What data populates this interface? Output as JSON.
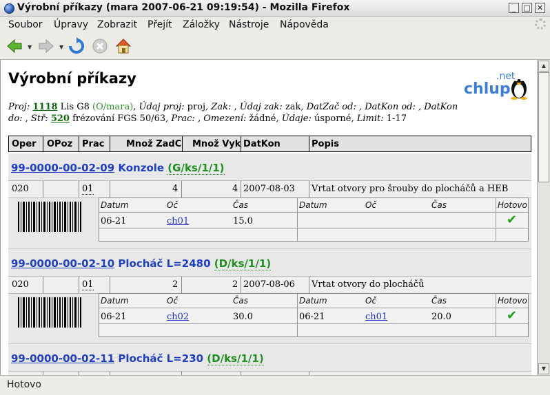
{
  "window": {
    "title": "Výrobní příkazy (mara 2007-06-21 09:19:54) - Mozilla Firefox",
    "buttons": {
      "minimize": "_",
      "maximize": "□",
      "close": "✕"
    }
  },
  "menu": [
    "Soubor",
    "Úpravy",
    "Zobrazit",
    "Přejít",
    "Záložky",
    "Nástroje",
    "Nápověda"
  ],
  "toolbar": {
    "back": "back-arrow-icon",
    "forward": "forward-arrow-icon",
    "reload": "reload-icon",
    "stop": "stop-icon",
    "home": "home-icon"
  },
  "status": "Hotovo",
  "page": {
    "heading": "Výrobní příkazy",
    "logo": {
      "net": ".net",
      "chlup": "chlup"
    },
    "info": {
      "proj_label": "Proj:",
      "proj_num": "1118",
      "proj_name": " Lis G8 ",
      "proj_owner": "(O/mara)",
      "udaj_proj_label": ", Údaj proj:",
      "udaj_proj": " proj",
      "zak_label": ", Zak:",
      "zak": " ",
      "udaj_zak_label": ", Údaj zak:",
      "udaj_zak": " zak",
      "datzac_label": ", DatZač od:",
      "datzac": " ",
      "datkon_label": ", DatKon od:",
      "datkon": " ",
      "datkon_do_label": ", DatKon do:",
      "datkon_do": " ",
      "str_label": ", Stř:",
      "str_num": "520",
      "str_name": " frézování FGS 50/63",
      "prac_label": ", Prac:",
      "prac": " ",
      "omezeni_label": ", Omezení:",
      "omezeni": " žádné",
      "udaje_label": ", Údaje:",
      "udaje": " úsporné",
      "limit_label": ", Limit:",
      "limit": " 1-17"
    },
    "columns": [
      "Oper",
      "OPoz",
      "Prac",
      "Množ ZadC",
      "Množ Vyk",
      "DatKon",
      "Popis"
    ],
    "subcolumns": [
      "Datum",
      "Oč",
      "Čas",
      "Datum",
      "Oč",
      "Čas",
      "Hotovo"
    ],
    "orders": [
      {
        "code": "99-0000-00-02-09",
        "name": " Konzole ",
        "cls": "(G/ks/1/1)",
        "oper": "020",
        "opoz": "",
        "prac": "01",
        "zad": "4",
        "vyk": "4",
        "datkon": "2007-08-03",
        "popis": "Vrtat otvory pro šrouby do plocháčů a HEB",
        "log1": {
          "datum": "06-21",
          "oc": "ch01",
          "cas": "15.0"
        },
        "log2": {
          "datum": "",
          "oc": "",
          "cas": ""
        },
        "done": "✔"
      },
      {
        "code": "99-0000-00-02-10",
        "name": " Plocháč L=2480 ",
        "cls": "(D/ks/1/1)",
        "oper": "020",
        "opoz": "",
        "prac": "01",
        "zad": "2",
        "vyk": "2",
        "datkon": "2007-08-06",
        "popis": "Vrtat otvory do plocháčů",
        "log1": {
          "datum": "06-21",
          "oc": "ch02",
          "cas": "30.0"
        },
        "log2": {
          "datum": "06-21",
          "oc": "ch01",
          "cas": "20.0"
        },
        "done": "✔"
      },
      {
        "code": "99-0000-00-02-11",
        "name": " Plocháč L=230 ",
        "cls": "(D/ks/1/1)"
      }
    ]
  }
}
